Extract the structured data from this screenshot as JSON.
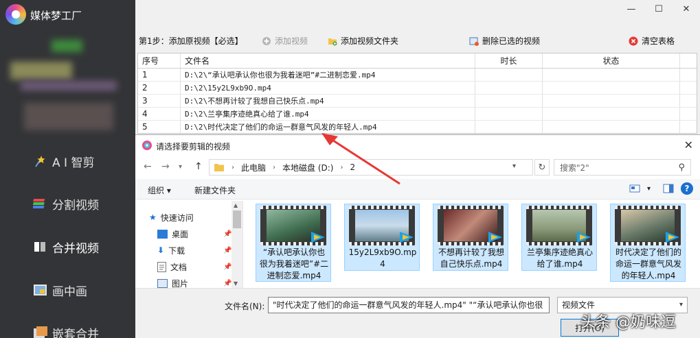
{
  "app": {
    "title": "媒体梦工厂",
    "window_controls": {
      "minimize": "—",
      "maximize": "☐",
      "close": "✕"
    }
  },
  "sidebar": {
    "items": [
      {
        "label": "A I 智剪",
        "icon": "ai-star-icon"
      },
      {
        "label": "分割视频",
        "icon": "layers-icon"
      },
      {
        "label": "合并视频",
        "icon": "merge-icon"
      },
      {
        "label": "画中画",
        "icon": "picture-in-picture-icon"
      },
      {
        "label": "嵌套合并",
        "icon": "nested-icon"
      }
    ]
  },
  "toolbar": {
    "step_label": "第1步：添加原视频【必选】",
    "add_video": "添加视频",
    "add_folder": "添加视频文件夹",
    "delete_selected": "删除已选的视频",
    "clear_table": "清空表格"
  },
  "table": {
    "headers": [
      "序号",
      "文件名",
      "时长",
      "状态"
    ],
    "rows": [
      {
        "no": "1",
        "file": "D:\\2\\“承认吧承认你也很为我着迷吧”#二进制恋爱.mp4",
        "duration": "",
        "status": ""
      },
      {
        "no": "2",
        "file": "D:\\2\\15y2L9xb9O.mp4",
        "duration": "",
        "status": ""
      },
      {
        "no": "3",
        "file": "D:\\2\\不想再计较了我想自己快乐点.mp4",
        "duration": "",
        "status": ""
      },
      {
        "no": "4",
        "file": "D:\\2\\兰亭集序迹绝真心给了谁.mp4",
        "duration": "",
        "status": ""
      },
      {
        "no": "5",
        "file": "D:\\2\\时代决定了他们的命运一群意气风发的年轻人.mp4",
        "duration": "",
        "status": ""
      }
    ]
  },
  "dialog": {
    "title": "请选择要剪辑的视频",
    "close": "✕",
    "breadcrumb": [
      "此电脑",
      "本地磁盘 (D:)",
      "2"
    ],
    "search_placeholder": "搜索\"2\"",
    "organize": "组织 ▾",
    "new_folder": "新建文件夹",
    "nav_pane": [
      {
        "label": "快速访问"
      },
      {
        "label": "桌面"
      },
      {
        "label": "下载"
      },
      {
        "label": "文档"
      },
      {
        "label": "图片"
      }
    ],
    "files": [
      {
        "name": "“承认吧承认你也很为我着迷吧”#二进制恋爱.mp4"
      },
      {
        "name": "15y2L9xb9O.mp4"
      },
      {
        "name": "不想再计较了我想自己快乐点.mp4"
      },
      {
        "name": "兰亭集序迹绝真心给了谁.mp4"
      },
      {
        "name": "时代决定了他们的命运一群意气风发的年轻人.mp4"
      }
    ],
    "filename_label": "文件名(N):",
    "filename_value": "\"时代决定了他们的命运一群意气风发的年轻人.mp4\" \"“承认吧承认你也很",
    "filetype": "视频文件",
    "open_button": "打开(O)"
  },
  "watermark": "头条 @奶味逗",
  "colors": {
    "sidebar_bg": "#333437",
    "selection_bg": "#cce8ff",
    "selection_border": "#99d1ff",
    "arrow_red": "#e53935",
    "accent_blue": "#0078d7"
  }
}
